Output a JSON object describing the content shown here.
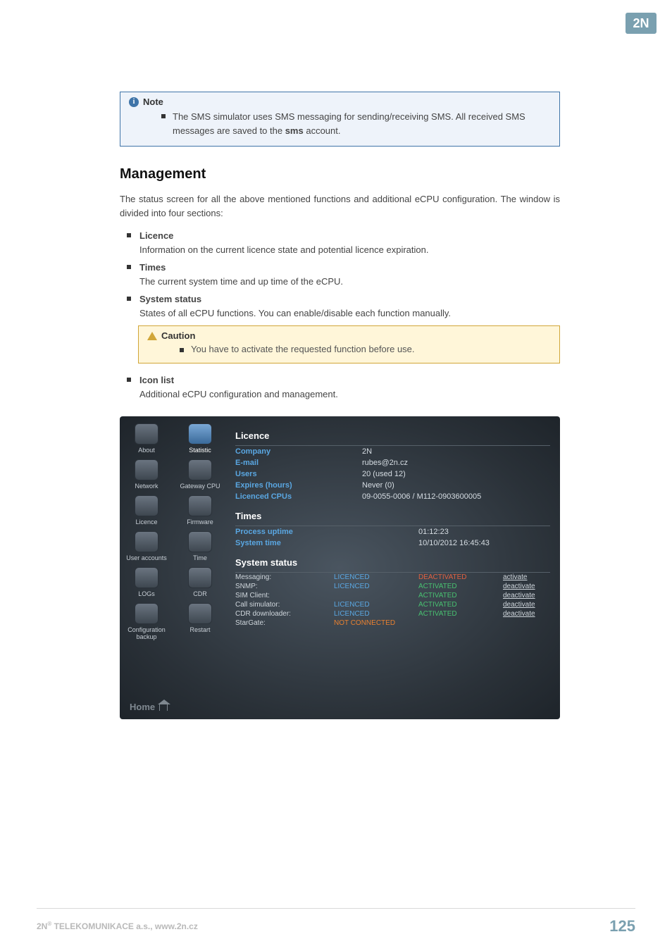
{
  "logo_text": "2N",
  "note": {
    "title": "Note",
    "body_prefix": "The SMS simulator uses SMS messaging for sending/receiving SMS. All received SMS messages are saved to the ",
    "body_bold": "sms",
    "body_suffix": " account."
  },
  "management": {
    "heading": "Management",
    "intro": "The status screen for all the above mentioned functions and additional eCPU configuration. The window is divided into four sections:",
    "items": [
      {
        "term": "Licence",
        "desc": "Information on the current licence state and potential licence expiration."
      },
      {
        "term": "Times",
        "desc": "The current system time and up time of the eCPU."
      },
      {
        "term": "System status",
        "desc": "States of all eCPU functions. You can enable/disable each function manually."
      }
    ],
    "caution": {
      "title": "Caution",
      "body": "You have to activate the requested function before use."
    },
    "items_after": [
      {
        "term": "Icon list",
        "desc": "Additional eCPU configuration and management."
      }
    ]
  },
  "screenshot": {
    "nav": [
      "About",
      "Statistic",
      "Network",
      "Gateway CPU",
      "Licence",
      "Firmware",
      "User accounts",
      "Time",
      "LOGs",
      "CDR",
      "Configuration backup",
      "Restart"
    ],
    "selected_nav_index": 1,
    "home_label": "Home",
    "licence": {
      "heading": "Licence",
      "rows": [
        {
          "label": "Company",
          "value": "2N"
        },
        {
          "label": "E-mail",
          "value": "rubes@2n.cz"
        },
        {
          "label": "Users",
          "value": "20 (used 12)"
        },
        {
          "label": "Expires (hours)",
          "value": "Never (0)"
        },
        {
          "label": "Licenced CPUs",
          "value": "09-0055-0006 / M112-0903600005"
        }
      ]
    },
    "times": {
      "heading": "Times",
      "rows": [
        {
          "label": "Process uptime",
          "value": "01:12:23"
        },
        {
          "label": "System time",
          "value": "10/10/2012 16:45:43"
        }
      ]
    },
    "system_status": {
      "heading": "System status",
      "rows": [
        {
          "name": "Messaging:",
          "lic": "LICENCED",
          "state": "DEACTIVATED",
          "state_cls": "deact",
          "action": "activate"
        },
        {
          "name": "SNMP:",
          "lic": "LICENCED",
          "state": "ACTIVATED",
          "state_cls": "act",
          "action": "deactivate"
        },
        {
          "name": "SIM Client:",
          "lic": "",
          "state": "ACTIVATED",
          "state_cls": "act",
          "action": "deactivate"
        },
        {
          "name": "Call simulator:",
          "lic": "LICENCED",
          "state": "ACTIVATED",
          "state_cls": "act",
          "action": "deactivate"
        },
        {
          "name": "CDR downloader:",
          "lic": "LICENCED",
          "state": "ACTIVATED",
          "state_cls": "act",
          "action": "deactivate"
        },
        {
          "name": "StarGate:",
          "lic": "NOT CONNECTED",
          "lic_cls": "notc",
          "state": "",
          "state_cls": "",
          "action": ""
        }
      ]
    }
  },
  "footer": {
    "left_prefix": "2N",
    "left_sup": "®",
    "left_rest": " TELEKOMUNIKACE a.s., www.2n.cz",
    "page": "125"
  }
}
